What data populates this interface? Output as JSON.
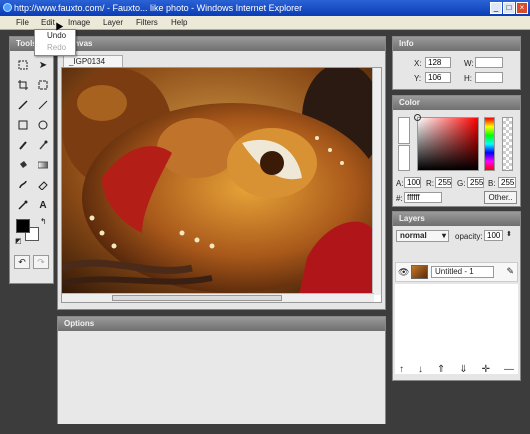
{
  "window": {
    "title": "http://www.fauxto.com/ - Fauxto... like photo - Windows Internet Explorer"
  },
  "menu": [
    "File",
    "Edit",
    "Image",
    "Layer",
    "Filters",
    "Help"
  ],
  "edit_menu": {
    "undo": "Undo",
    "redo": "Redo"
  },
  "panels": {
    "tools": "Tools",
    "canvas": "Canvas",
    "options": "Options",
    "info": "Info",
    "color": "Color",
    "layers": "Layers"
  },
  "canvas": {
    "tab_label": "_IGP0134"
  },
  "info": {
    "x_label": "X:",
    "x_value": "128",
    "y_label": "Y:",
    "y_value": "106",
    "w_label": "W:",
    "w_value": "",
    "h_label": "H:",
    "h_value": ""
  },
  "color": {
    "a_label": "A:",
    "a_value": "100",
    "r_label": "R:",
    "r_value": "255",
    "g_label": "G:",
    "g_value": "255",
    "b_label": "B:",
    "b_value": "255",
    "hex_label": "#:",
    "hex_value": "ffffff",
    "other_label": "Other.."
  },
  "layers": {
    "blend_mode": "normal",
    "opacity_label": "opacity:",
    "opacity_value": "100",
    "layer_name": "Untitled - 1"
  },
  "colors": {
    "title_bar": "#0a3cb5",
    "panel_head": "#777777",
    "background": "#3c3c3c"
  }
}
